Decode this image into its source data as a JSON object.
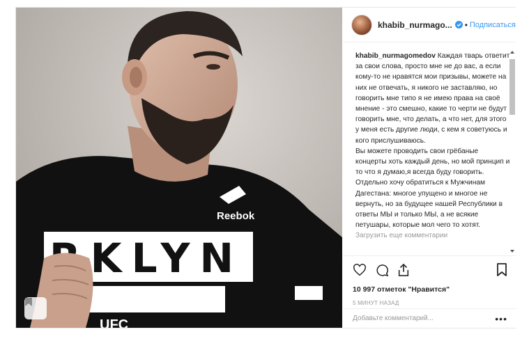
{
  "post": {
    "username": "khabib_nurmago...",
    "separator": "•",
    "follow_label": "Подписаться",
    "caption_user": "khabib_nurmagomedov",
    "caption_paragraphs": [
      "Каждая тварь ответит за свои слова, просто мне не до вас, а если кому-то не нравятся мои призывы, можете на них не отвечать, я никого не заставляю, но говорить мне типо я не имею права на своё мнение - это смешно, какие то черти не будут говорить мне, что делать, а что нет, для этого у меня есть другие люди, с кем я советуюсь и кого прислушиваюсь.",
      "Вы можете проводить свои грёбаные концерты хоть каждый день, но мой принцип и то что я думаю,я всегда буду говорить.",
      "Отдельно хочу обратиться к Мужчинам Дагестана: многое упущено и многое не вернуть, но за будущее нашей Республики в ответы МЫ и только МЫ, а не всякие петушары, которые мол чего то хотят."
    ],
    "more_comments_label": "Загрузить еще комментарии",
    "likes_label": "10 997 отметок \"Нравится\"",
    "time_label": "5 минут назад",
    "comment_placeholder": "Добавьте комментарий...",
    "more_options_label": "•••"
  },
  "photo": {
    "shirt_text": "RKLYN",
    "shirt_text_2": "UFC",
    "brand": "Reebok"
  },
  "icons": {
    "like": "heart-icon",
    "comment": "comment-icon",
    "share": "share-icon",
    "save": "bookmark-icon",
    "verified": "verified-badge-icon"
  },
  "colors": {
    "accent": "#3897f0",
    "text": "#262626",
    "muted": "#999999"
  }
}
